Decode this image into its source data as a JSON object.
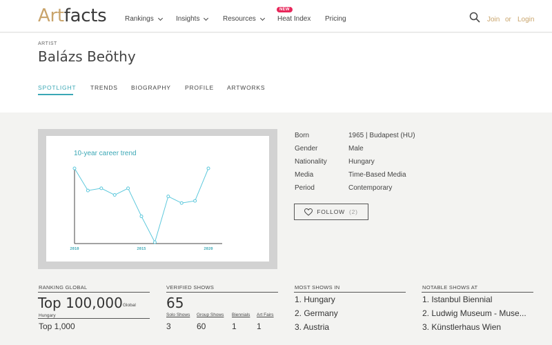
{
  "nav": {
    "logo_art": "Art",
    "logo_facts": "facts",
    "items": [
      "Rankings",
      "Insights",
      "Resources"
    ],
    "heat_index": "Heat Index",
    "heat_badge": "NEW",
    "pricing": "Pricing",
    "join": "Join",
    "or": "or",
    "login": "Login"
  },
  "artist": {
    "label": "ARTIST",
    "name": "Balázs Beöthy"
  },
  "tabs": [
    "SPOTLIGHT",
    "TRENDS",
    "BIOGRAPHY",
    "PROFILE",
    "ARTWORKS"
  ],
  "chart_data": {
    "type": "line",
    "title": "10-year career trend",
    "x": [
      2010,
      2011,
      2012,
      2013,
      2014,
      2015,
      2016,
      2017,
      2018,
      2019,
      2020
    ],
    "xticks": [
      "2010",
      "2015",
      "2020"
    ],
    "series": [
      {
        "values": [
          100,
          70,
          73,
          64,
          73,
          35,
          0,
          62,
          53,
          56,
          100
        ]
      }
    ],
    "ylim": [
      0,
      100
    ],
    "color": "#5cc8dc"
  },
  "facts": [
    {
      "key": "Born",
      "value": "1965 | Budapest (HU)"
    },
    {
      "key": "Gender",
      "value": "Male"
    },
    {
      "key": "Nationality",
      "value": "Hungary"
    },
    {
      "key": "Media",
      "value": "Time-Based Media"
    },
    {
      "key": "Period",
      "value": "Contemporary"
    }
  ],
  "follow": {
    "label": "FOLLOW",
    "count": "(2)"
  },
  "stats": {
    "ranking": {
      "head": "RANKING GLOBAL",
      "value": "Top 100,000",
      "scope": "Global",
      "country": "Hungary",
      "country_value": "Top 1,000"
    },
    "verified": {
      "head": "VERIFIED SHOWS",
      "total": "65",
      "labels": [
        "Solo Shows",
        "Group Shows",
        "Biennials",
        "Art Fairs"
      ],
      "values": [
        "3",
        "60",
        "1",
        "1"
      ]
    },
    "most_shows": {
      "head": "MOST SHOWS IN",
      "items": [
        "1. Hungary",
        "2. Germany",
        "3. Austria"
      ]
    },
    "notable": {
      "head": "NOTABLE SHOWS AT",
      "items": [
        "1. Istanbul Biennial",
        "2. Ludwig Museum - Muse...",
        "3. Künstlerhaus Wien"
      ]
    }
  }
}
